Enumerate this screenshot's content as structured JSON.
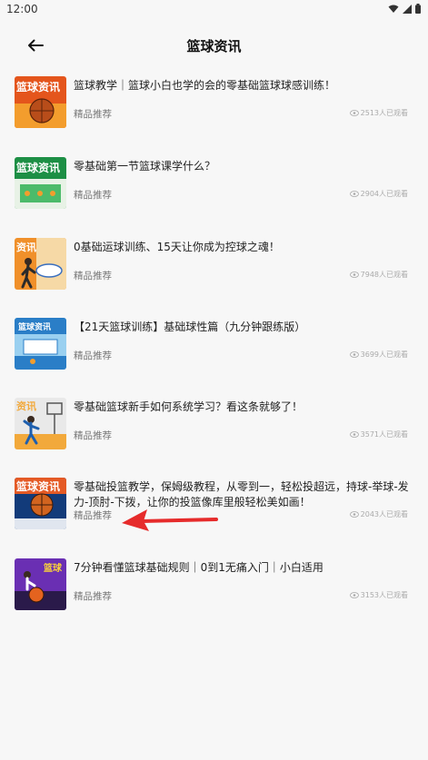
{
  "status": {
    "time": "12:00"
  },
  "header": {
    "title": "篮球资讯"
  },
  "articles": [
    {
      "title": "篮球教学｜篮球小白也学的会的零基础篮球球感训练！",
      "tag": "精品推荐",
      "views": "2513人已观看",
      "thumb_text": "篮球资讯",
      "thumb_colors": [
        "#e4551c",
        "#f39d2d"
      ],
      "thumb_icon": "basketball"
    },
    {
      "title": "零基础第一节篮球课学什么？",
      "tag": "精品推荐",
      "views": "2904人已观看",
      "thumb_text": "篮球资讯",
      "thumb_colors": [
        "#1d8f45",
        "#4cbb6a"
      ],
      "thumb_icon": "court"
    },
    {
      "title": "0基础运球训练、15天让你成为控球之魂！",
      "tag": "精品推荐",
      "views": "7948人已观看",
      "thumb_text": "资讯",
      "thumb_colors": [
        "#f0902a",
        "#f6d9a6"
      ],
      "thumb_icon": "player"
    },
    {
      "title": "【21天篮球训练】基础球性篇（九分钟跟练版）",
      "tag": "精品推荐",
      "views": "3699人已观看",
      "thumb_text": "篮球资讯",
      "thumb_colors": [
        "#2a7ec7",
        "#9ad0f0"
      ],
      "thumb_icon": "court"
    },
    {
      "title": "零基础篮球新手如何系统学习？看这条就够了！",
      "tag": "精品推荐",
      "views": "3571人已观看",
      "thumb_text": "资讯",
      "thumb_colors": [
        "#f2a93b",
        "#e9e9e9"
      ],
      "thumb_icon": "player"
    },
    {
      "title": "零基础投篮教学，保姆级教程，从零到一，轻松投超远，持球-举球-发力-顶肘-下拨，让你的投篮像库里般轻松美如画！",
      "tag": "精品推荐",
      "views": "2043人已观看",
      "thumb_text": "篮球资讯",
      "thumb_colors": [
        "#123b7a",
        "#e45a25"
      ],
      "thumb_icon": "basketball"
    },
    {
      "title": "7分钟看懂篮球基础规则｜0到1无痛入门｜小白适用",
      "tag": "精品推荐",
      "views": "3153人已观看",
      "thumb_text": "篮球",
      "thumb_colors": [
        "#6a2fb3",
        "#e4631f"
      ],
      "thumb_icon": "basketball"
    }
  ],
  "colors": {
    "arrow": "#e62b2b",
    "background": "#f7f7f7"
  }
}
